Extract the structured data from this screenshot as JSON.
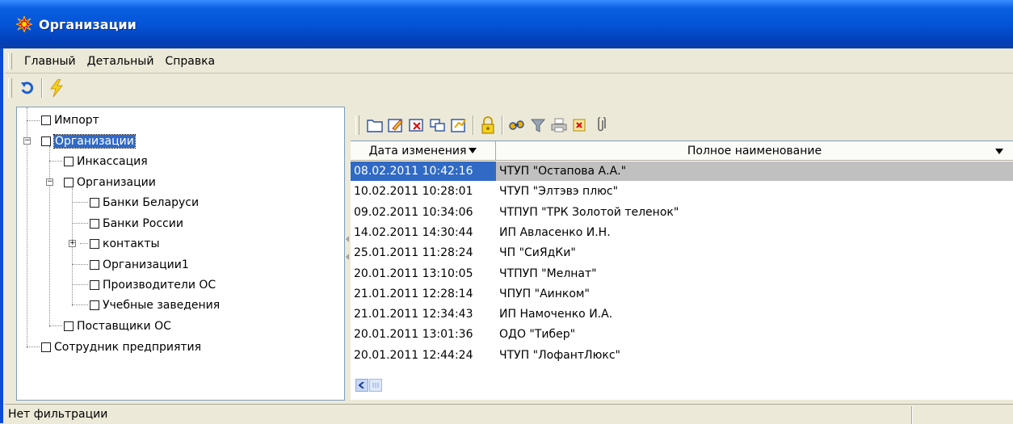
{
  "window": {
    "title": "Организации",
    "icon": "red-star-icon"
  },
  "menu": {
    "items": [
      "Главный",
      "Детальный",
      "Справка"
    ]
  },
  "toolbar": {
    "icons": [
      "refresh-icon",
      "lightning-icon"
    ]
  },
  "tree": {
    "nodes": [
      {
        "label": "Импорт",
        "level": 0
      },
      {
        "label": "Организации",
        "level": 0,
        "expanded": true,
        "selected": true
      },
      {
        "label": "Инкассация",
        "level": 1
      },
      {
        "label": "Организации",
        "level": 1,
        "expanded": true
      },
      {
        "label": "Банки Беларуси",
        "level": 2
      },
      {
        "label": "Банки России",
        "level": 2
      },
      {
        "label": "контакты",
        "level": 2,
        "collapsed": true
      },
      {
        "label": "Организации1",
        "level": 2
      },
      {
        "label": "Производители ОС",
        "level": 2
      },
      {
        "label": "Учебные заведения",
        "level": 2
      },
      {
        "label": "Поставщики ОС",
        "level": 1
      },
      {
        "label": "Сотрудник предприятия",
        "level": 0
      }
    ]
  },
  "grid_toolbar": {
    "icons": [
      "folder-icon",
      "edit-icon",
      "delete-icon",
      "copy-icon",
      "export-icon",
      "lock-icon",
      "search-icon",
      "filter-icon",
      "print-icon",
      "report-icon",
      "attach-icon"
    ]
  },
  "grid": {
    "columns": [
      "Дата изменения",
      "Полное наименование"
    ],
    "rows": [
      {
        "date": "08.02.2011 10:42:16",
        "name": "ЧТУП \"Остапова А.А.\""
      },
      {
        "date": "10.02.2011 10:28:01",
        "name": "ЧТУП \"Элтэвэ плюс\""
      },
      {
        "date": "09.02.2011 10:34:06",
        "name": "ЧТПУП \"ТРК Золотой теленок\""
      },
      {
        "date": "14.02.2011 14:30:44",
        "name": "ИП Авласенко И.Н."
      },
      {
        "date": "25.01.2011 11:28:24",
        "name": "ЧП \"СиЯдКи\""
      },
      {
        "date": "20.01.2011 13:10:05",
        "name": "ЧТПУП \"Мелнат\""
      },
      {
        "date": "21.01.2011 12:28:14",
        "name": "ЧПУП \"Аинком\""
      },
      {
        "date": "21.01.2011 12:34:43",
        "name": "ИП Намоченко И.А."
      },
      {
        "date": "20.01.2011 13:01:36",
        "name": "ОДО \"Тибер\""
      },
      {
        "date": "20.01.2011 12:44:24",
        "name": "ЧТУП \"ЛофантЛюкс\""
      }
    ],
    "selected_row": 0
  },
  "status": {
    "text": "Нет фильтрации"
  },
  "colors": {
    "title_blue": "#0454d8",
    "selection": "#316ac5",
    "face": "#ece9d8"
  }
}
